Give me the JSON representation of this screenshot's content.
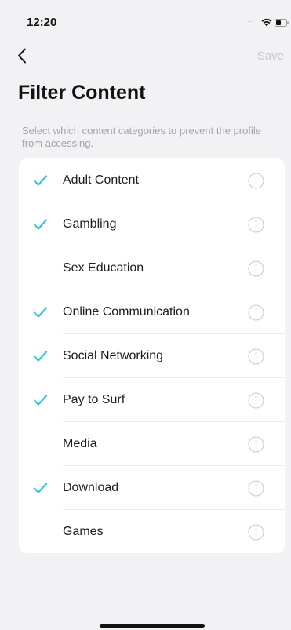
{
  "status_bar": {
    "time": "12:20",
    "signal_dots": "....",
    "icons": [
      "wifi-icon",
      "battery-icon"
    ]
  },
  "nav": {
    "back_icon": "chevron-left-icon",
    "save_label": "Save"
  },
  "page": {
    "title": "Filter Content",
    "description": "Select which content categories to prevent the profile from accessing."
  },
  "colors": {
    "check": "#2EC6D8",
    "save_disabled": "#C8C8CC",
    "description": "#A3A3A8",
    "info_icon": "#C7C7CC"
  },
  "categories": [
    {
      "label": "Adult Content",
      "checked": true
    },
    {
      "label": "Gambling",
      "checked": true
    },
    {
      "label": "Sex Education",
      "checked": false
    },
    {
      "label": "Online Communication",
      "checked": true
    },
    {
      "label": "Social Networking",
      "checked": true
    },
    {
      "label": "Pay to Surf",
      "checked": true
    },
    {
      "label": "Media",
      "checked": false
    },
    {
      "label": "Download",
      "checked": true
    },
    {
      "label": "Games",
      "checked": false
    }
  ]
}
